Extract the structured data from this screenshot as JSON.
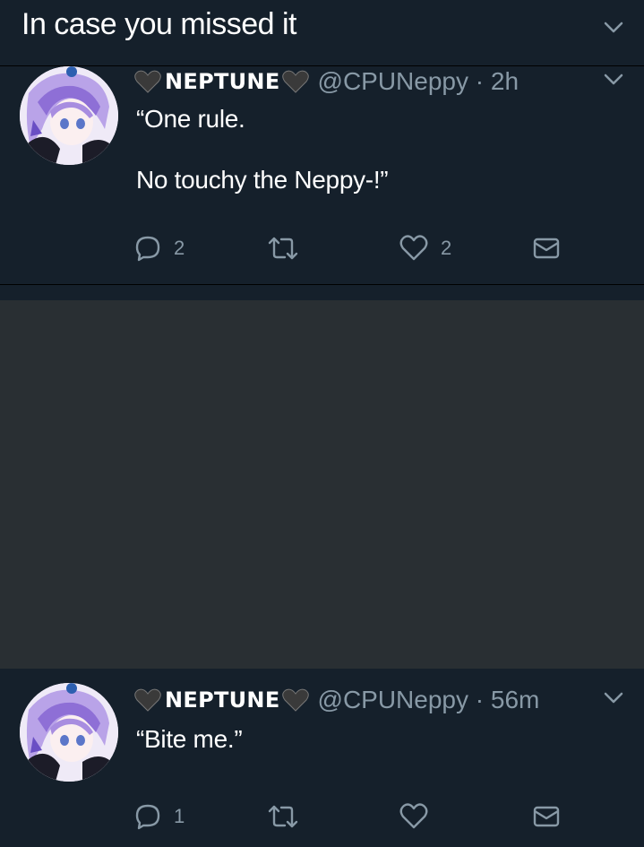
{
  "header": {
    "title": "In case you missed it"
  },
  "tweets": [
    {
      "name": "NEPTUNE",
      "handle": "@CPUNeppy · 2h",
      "text": "“One rule.\n\nNo touchy the Neppy-!”",
      "reply_count": "2",
      "like_count": "2"
    },
    {
      "name": "NEPTUNE",
      "handle": "@CPUNeppy · 56m",
      "text": "“Bite me.”",
      "reply_count": "1",
      "like_count": ""
    }
  ],
  "colors": {
    "background": "#15202b",
    "secondary_text": "#8899a6",
    "gap": "#292f33"
  }
}
